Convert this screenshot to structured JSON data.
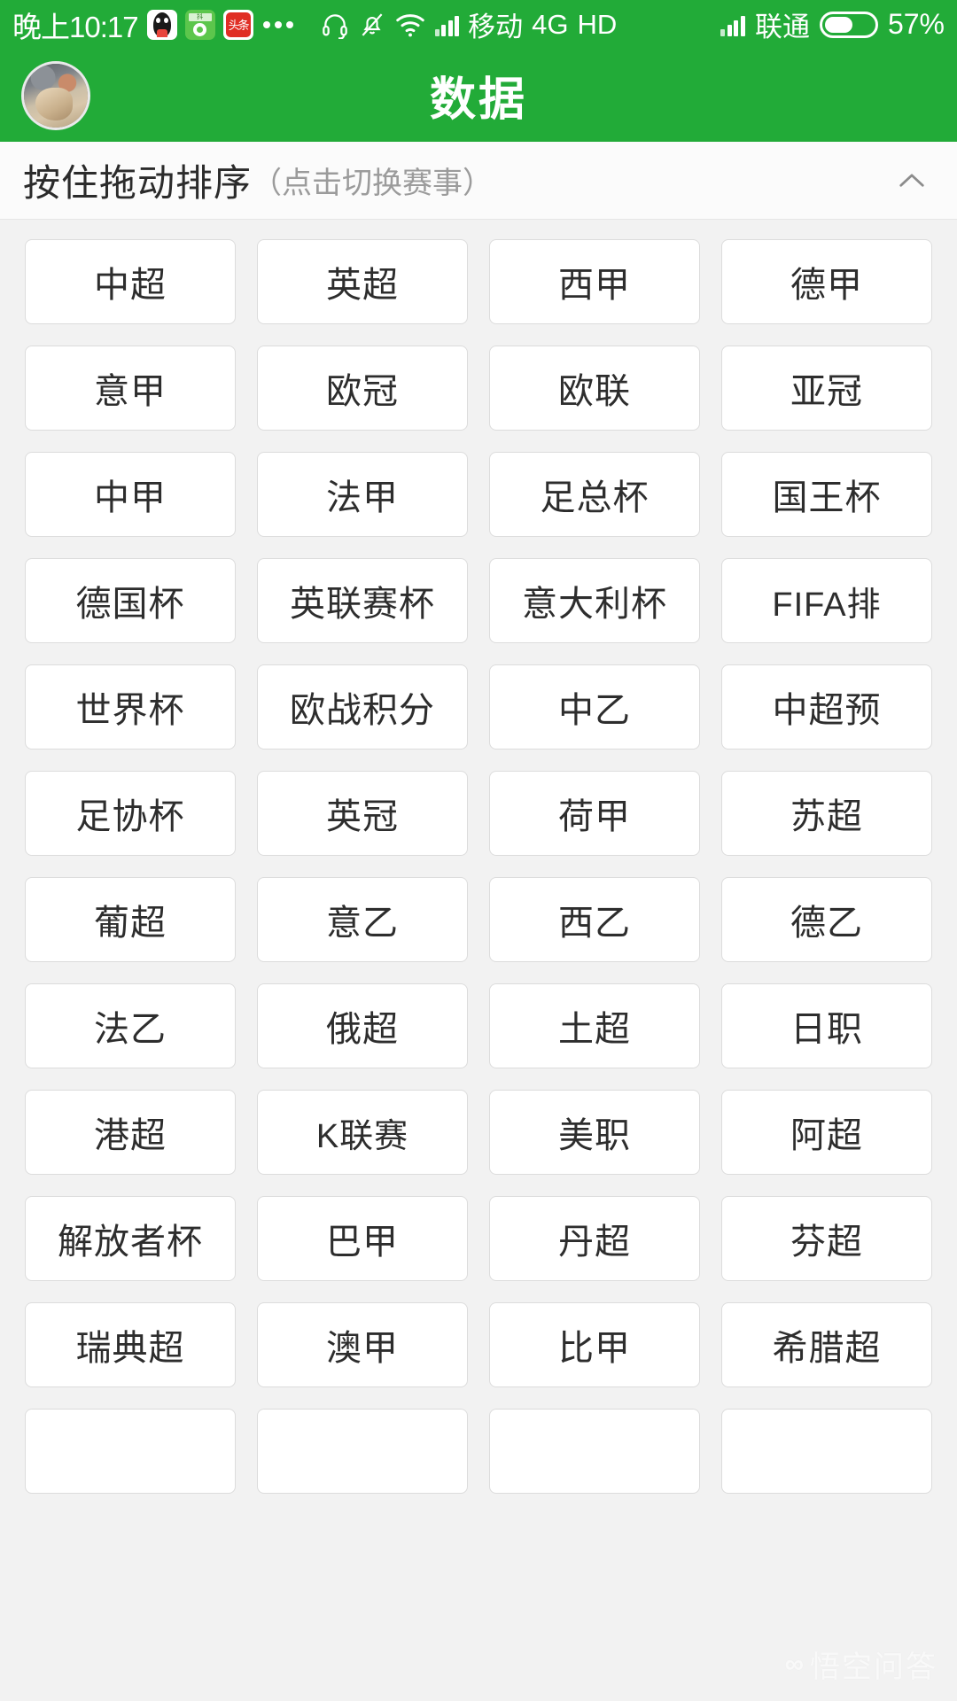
{
  "status_bar": {
    "time": "晚上10:17",
    "app_icons": [
      "qq-icon",
      "green-app-icon",
      "toutiao-icon"
    ],
    "overflow": "...",
    "headset_icon": "headset-icon",
    "mute_icon": "bell-muted-icon",
    "wifi_icon": "wifi-icon",
    "signal_icon_1": "signal-bars-icon",
    "carrier_1": "移动",
    "network_type": "4G",
    "hd_label": "HD",
    "signal_icon_2": "signal-bars-icon",
    "carrier_2": "联通",
    "battery_icon": "battery-icon",
    "battery_percent": "57%",
    "battery_level": 57
  },
  "app_bar": {
    "avatar": "user-avatar",
    "title": "数据"
  },
  "section_header": {
    "main_text": "按住拖动排序",
    "sub_text": "（点击切换赛事）",
    "collapse_icon": "chevron-up-icon"
  },
  "leagues": [
    "中超",
    "英超",
    "西甲",
    "德甲",
    "意甲",
    "欧冠",
    "欧联",
    "亚冠",
    "中甲",
    "法甲",
    "足总杯",
    "国王杯",
    "德国杯",
    "英联赛杯",
    "意大利杯",
    "FIFA排",
    "世界杯",
    "欧战积分",
    "中乙",
    "中超预",
    "足协杯",
    "英冠",
    "荷甲",
    "苏超",
    "葡超",
    "意乙",
    "西乙",
    "德乙",
    "法乙",
    "俄超",
    "土超",
    "日职",
    "港超",
    "K联赛",
    "美职",
    "阿超",
    "解放者杯",
    "巴甲",
    "丹超",
    "芬超",
    "瑞典超",
    "澳甲",
    "比甲",
    "希腊超",
    "",
    "",
    "",
    ""
  ],
  "watermark": {
    "logo": "悟空问答-logo",
    "text": "悟空问答"
  },
  "colors": {
    "brand_green": "#22ab38",
    "page_background": "#f2f2f2",
    "card_background": "#ffffff",
    "card_border": "#dcdcdc",
    "text_primary": "#2d2d2d",
    "text_secondary": "#9b9b9b"
  }
}
